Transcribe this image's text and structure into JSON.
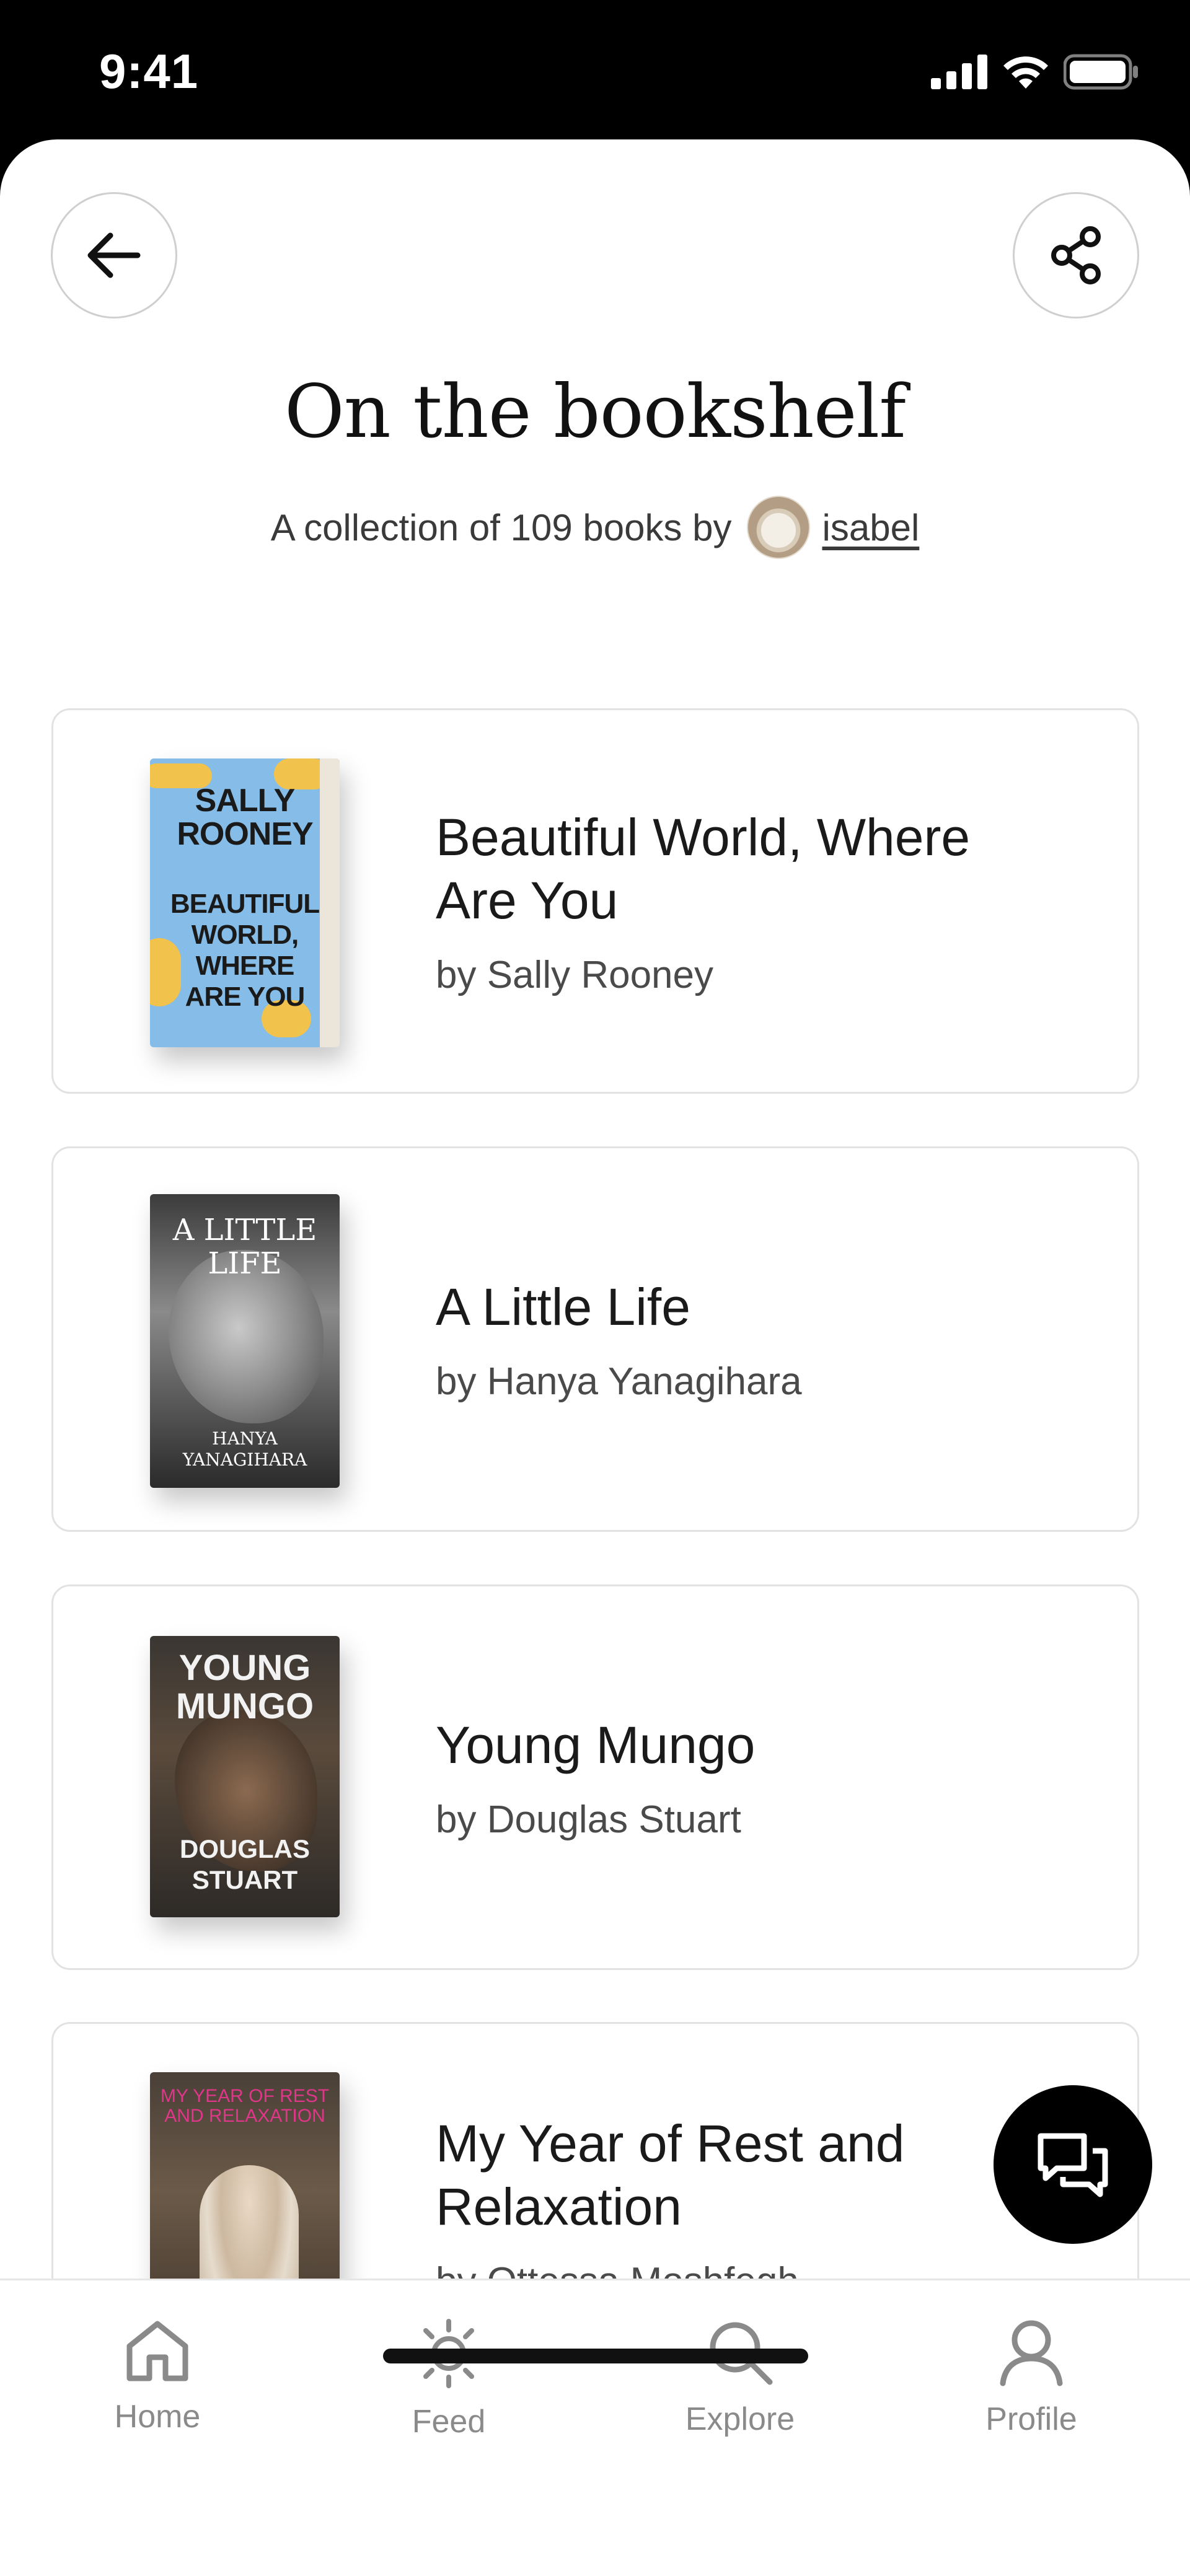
{
  "status_bar": {
    "time": "9:41"
  },
  "header": {
    "title": "On the bookshelf",
    "subtitle_prefix": "A collection of 109 books by",
    "username": "isabel"
  },
  "books": [
    {
      "title": "Beautiful World, Where Are You",
      "author": "by Sally Rooney",
      "cover": {
        "line1": "SALLY",
        "line2": "ROONEY",
        "line3": "BEAUTIFUL",
        "line4": "WORLD,",
        "line5": "WHERE",
        "line6": "ARE YOU"
      }
    },
    {
      "title": "A Little Life",
      "author": "by Hanya Yanagihara",
      "cover": {
        "line1": "A LITTLE",
        "line2": "LIFE",
        "line3": "HANYA",
        "line4": "YANAGIHARA"
      }
    },
    {
      "title": "Young Mungo",
      "author": "by Douglas Stuart",
      "cover": {
        "line1": "YOUNG",
        "line2": "MUNGO",
        "line3": "DOUGLAS",
        "line4": "STUART"
      }
    },
    {
      "title": "My Year of Rest and Relaxation",
      "author": "by Ottessa Moshfegh",
      "cover": {
        "line1": "MY YEAR OF REST",
        "line2": "AND RELAXATION"
      }
    }
  ],
  "nav": {
    "home": "Home",
    "feed": "Feed",
    "explore": "Explore",
    "profile": "Profile"
  },
  "icons": {
    "back": "arrow-left-icon",
    "share": "share-icon",
    "chat": "chat-bubbles-icon",
    "home": "home-icon",
    "feed": "sun-icon",
    "explore": "search-icon",
    "profile": "user-icon"
  },
  "colors": {
    "accent": "#000000",
    "nav_inactive": "#8a8a8a",
    "card_border": "#e2e2e2"
  }
}
